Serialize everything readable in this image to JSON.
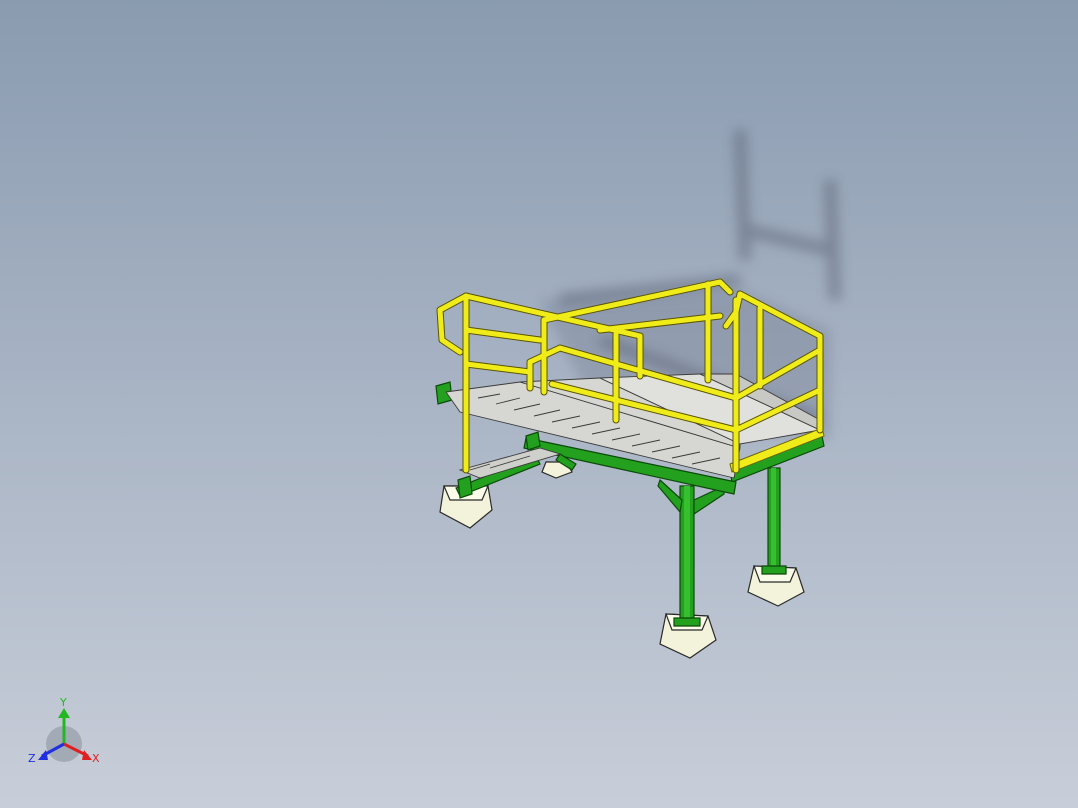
{
  "triad": {
    "x_label": "X",
    "y_label": "Y",
    "z_label": "Z"
  },
  "colors": {
    "background_top": "#8a9bb0",
    "background_bottom": "#c8ced9",
    "handrail": "#f0ec1a",
    "structure": "#22a01e",
    "treads": "#d3d3d0",
    "footing": "#f2f2dd",
    "axis_x": "#e02020",
    "axis_y": "#22b822",
    "axis_z": "#2030e0"
  }
}
